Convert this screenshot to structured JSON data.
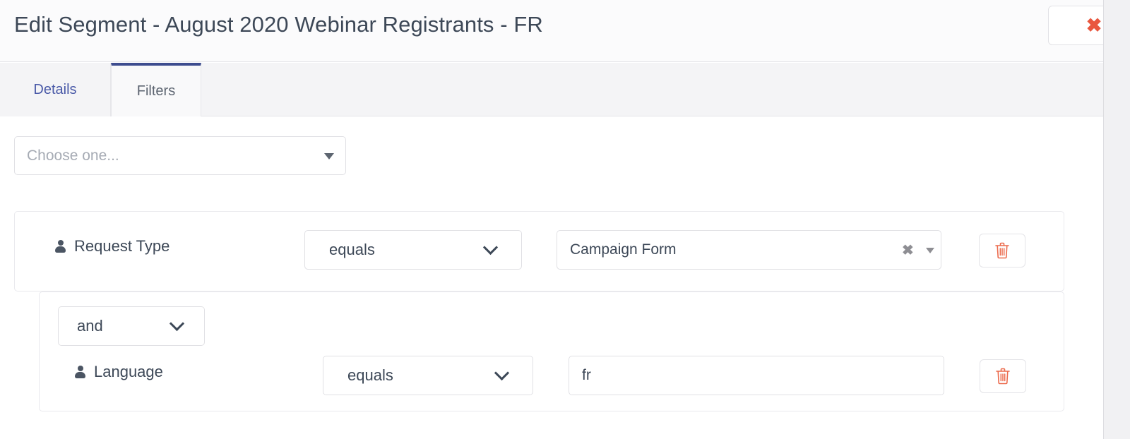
{
  "header": {
    "title": "Edit Segment - August 2020 Webinar Registrants - FR",
    "close_label": "✖",
    "close_color": "#e9573f"
  },
  "tabs": [
    {
      "label": "Details",
      "active": false
    },
    {
      "label": "Filters",
      "active": true
    }
  ],
  "toolbar": {
    "field_picker_placeholder": "Choose one...",
    "dropdown_arrow": "▼"
  },
  "filters": [
    {
      "field_label": "Request Type",
      "field_icon": "person-icon",
      "operator": "equals",
      "value": "Campaign Form",
      "value_type": "combobox",
      "clear_icon": "✖",
      "dropdown_arrow": "▼",
      "delete_icon": "trash-icon"
    },
    {
      "connector": "and",
      "field_label": "Language",
      "field_icon": "person-icon",
      "operator": "equals",
      "value": "fr",
      "value_type": "text",
      "delete_icon": "trash-icon"
    }
  ],
  "colors": {
    "accent_red": "#e9573f",
    "active_tab_border": "#3e4d8f",
    "link_blue": "#4a5aa8",
    "text_dark": "#3d4857",
    "placeholder_gray": "#a6abb4"
  }
}
